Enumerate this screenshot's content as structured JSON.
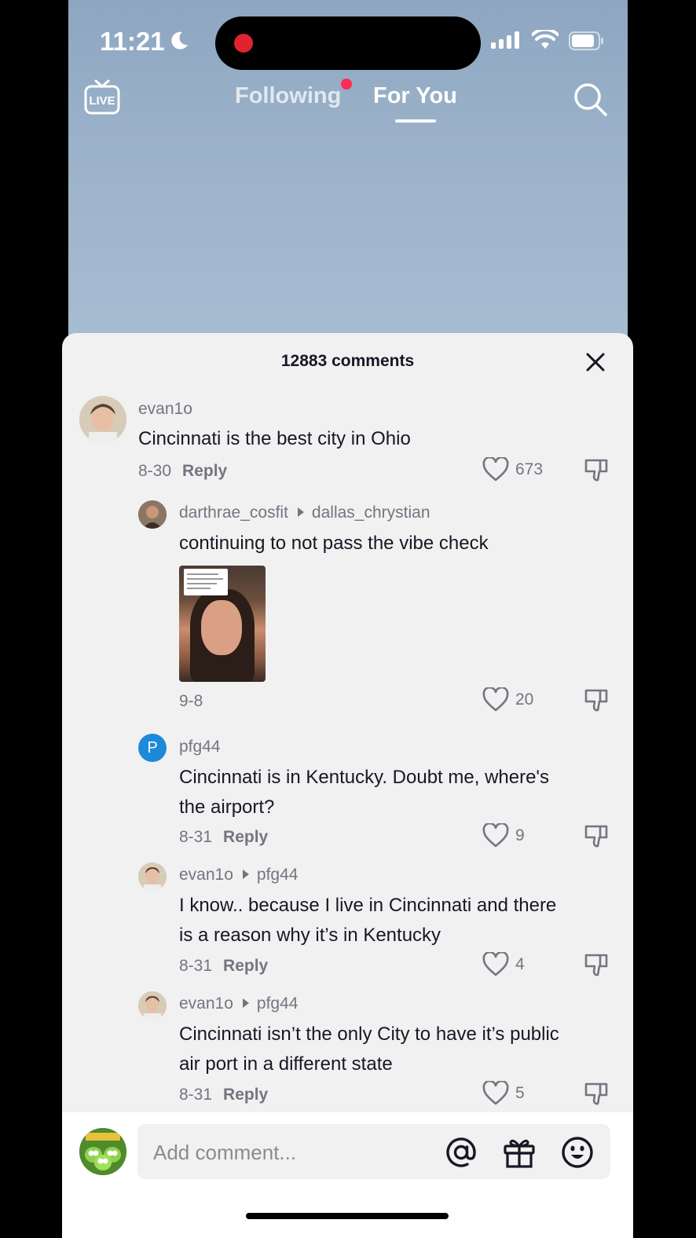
{
  "status_bar": {
    "time": "11:21"
  },
  "top_nav": {
    "live_label": "LIVE",
    "tabs": [
      {
        "label": "Following",
        "active": false,
        "has_dot": true
      },
      {
        "label": "For You",
        "active": true
      }
    ]
  },
  "comments_sheet": {
    "title": "12883 comments",
    "comments": [
      {
        "username": "evan1o",
        "text": "Cincinnati is the best city in Ohio",
        "date": "8-30",
        "reply_label": "Reply",
        "likes": "673"
      },
      {
        "username": "darthrae_cosfit",
        "reply_to": "dallas_chrystian",
        "text": "continuing to not pass the vibe check",
        "date": "9-8",
        "likes": "20",
        "has_video": true
      },
      {
        "username": "pfg44",
        "avatar_letter": "P",
        "text": "Cincinnati is in Kentucky. Doubt me, where's the airport?",
        "date": "8-31",
        "reply_label": "Reply",
        "likes": "9"
      },
      {
        "username": "evan1o",
        "reply_to": "pfg44",
        "text": "I know.. because I live in Cincinnati and there is a reason why it’s in Kentucky",
        "date": "8-31",
        "reply_label": "Reply",
        "likes": "4"
      },
      {
        "username": "evan1o",
        "reply_to": "pfg44",
        "text": "Cincinnati isn’t the only City to have it’s public air port in a different state",
        "date": "8-31",
        "reply_label": "Reply",
        "likes": "5"
      }
    ]
  },
  "comment_input": {
    "placeholder": "Add comment..."
  },
  "colors": {
    "accent": "#fe2c55",
    "text_primary": "#161823",
    "text_secondary": "#737580"
  }
}
